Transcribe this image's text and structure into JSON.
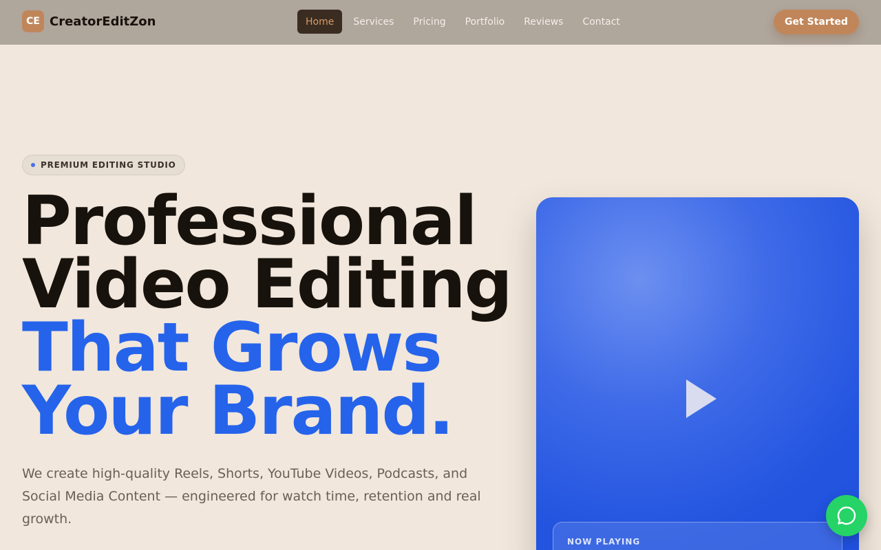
{
  "header": {
    "logo_badge": "CE",
    "logo_text": "CreatorEditZon",
    "nav": [
      {
        "label": "Home",
        "active": true
      },
      {
        "label": "Services"
      },
      {
        "label": "Pricing"
      },
      {
        "label": "Portfolio"
      },
      {
        "label": "Reviews"
      },
      {
        "label": "Contact"
      }
    ],
    "cta_label": "Get Started"
  },
  "hero": {
    "badge": "PREMIUM EDITING STUDIO",
    "headline_line1": "Professional",
    "headline_line2": "Video Editing",
    "headline_line3": "That Grows",
    "headline_line4": "Your Brand.",
    "description": "We create high-quality Reels, Shorts, YouTube Videos, Podcasts, and Social Media Content — engineered for watch time, retention and real growth."
  },
  "video": {
    "now_playing_label": "NOW PLAYING",
    "play_icon": "play-icon"
  },
  "chat": {
    "icon": "whatsapp-icon"
  },
  "colors": {
    "accent": "#c0865a",
    "blue": "#2563eb",
    "header_bg": "#afa69c",
    "page_bg": "#f1e7dc",
    "chat_green": "#25d366"
  }
}
